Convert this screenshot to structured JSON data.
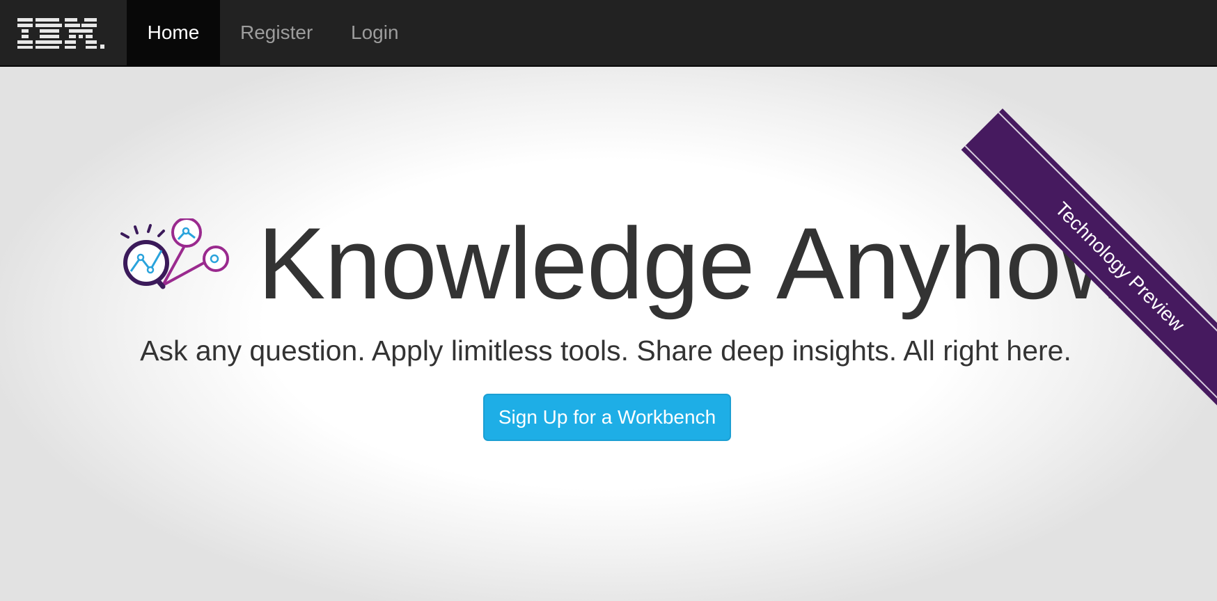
{
  "navbar": {
    "brand": "IBM.",
    "items": [
      {
        "label": "Home",
        "active": true
      },
      {
        "label": "Register",
        "active": false
      },
      {
        "label": "Login",
        "active": false
      }
    ]
  },
  "ribbon": {
    "label": "Technology Preview"
  },
  "hero": {
    "title": "Knowledge Anyhow",
    "subtitle": "Ask any question. Apply limitless tools. Share deep insights. All right here.",
    "cta_label": "Sign Up for a Workbench"
  },
  "colors": {
    "navbar_bg": "#222222",
    "active_nav_bg": "#080808",
    "ribbon": "#461a5f",
    "cta": "#1eaee6",
    "logo_purple": "#9a2a8e",
    "logo_dark": "#3b1a5a",
    "logo_blue": "#29a3dc"
  },
  "icons": {
    "brand_logo": "ibm-logo",
    "hero_logo": "magnifier-insight-icon"
  }
}
